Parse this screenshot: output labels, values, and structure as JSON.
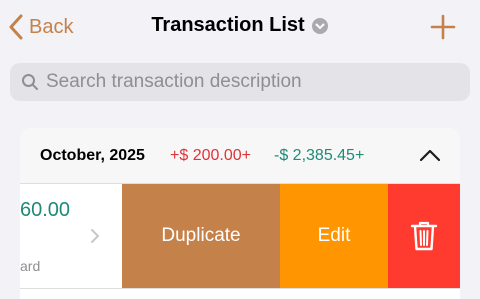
{
  "nav": {
    "back_label": "Back",
    "title": "Transaction List",
    "title_icon": "chevron-down-circle-icon",
    "add_icon": "plus-icon"
  },
  "search": {
    "placeholder": "Search transaction description",
    "value": ""
  },
  "section": {
    "month": "October, 2025",
    "income": "+$ 200.00+",
    "expense": "-$ 2,385.45+",
    "collapse_icon": "chevron-up-icon"
  },
  "row": {
    "amount_partial": "60.00",
    "account_partial": "ard",
    "actions": {
      "duplicate": "Duplicate",
      "edit": "Edit",
      "delete_icon": "trash-icon"
    }
  },
  "colors": {
    "accent": "#c4824a",
    "income": "#e0333a",
    "expense": "#1f8a78",
    "duplicate_bg": "#c5814a",
    "edit_bg": "#ff9500",
    "delete_bg": "#ff3b30"
  }
}
